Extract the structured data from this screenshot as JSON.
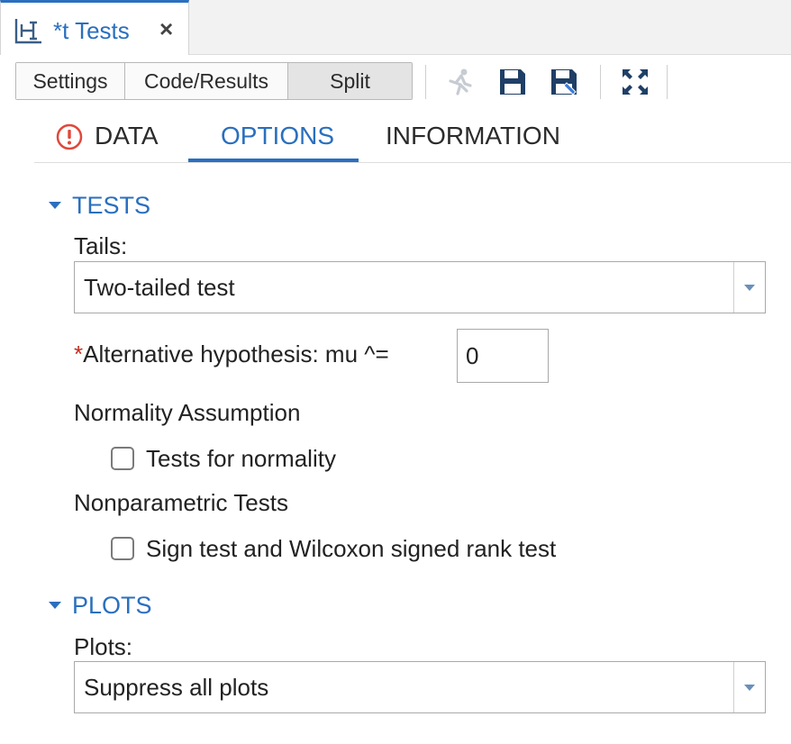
{
  "tab": {
    "title": "*t Tests",
    "close_glyph": "×",
    "icon": "t-test-task-icon"
  },
  "toolbar": {
    "view_buttons": [
      "Settings",
      "Code/Results",
      "Split"
    ],
    "active_view": "Split",
    "icons": [
      "run-icon",
      "save-icon",
      "save-as-icon",
      "maximize-icon"
    ]
  },
  "section_tabs": {
    "data": "DATA",
    "options": "OPTIONS",
    "information": "INFORMATION",
    "active": "OPTIONS"
  },
  "tests": {
    "header": "TESTS",
    "tails_label": "Tails:",
    "tails_value": "Two-tailed test",
    "alt_required_mark": "*",
    "alt_label": "Alternative hypothesis: mu ^=",
    "alt_value": "0",
    "normality_heading": "Normality Assumption",
    "normality_checkbox": "Tests for normality",
    "nonparam_heading": "Nonparametric Tests",
    "nonparam_checkbox": "Sign test and Wilcoxon signed rank test"
  },
  "plots": {
    "header": "PLOTS",
    "plots_label": "Plots:",
    "plots_value": "Suppress all plots"
  },
  "colors": {
    "accent": "#2a6fbf",
    "error": "#e0483a",
    "required": "#c42b1c",
    "icon_navy": "#1f3f66"
  }
}
